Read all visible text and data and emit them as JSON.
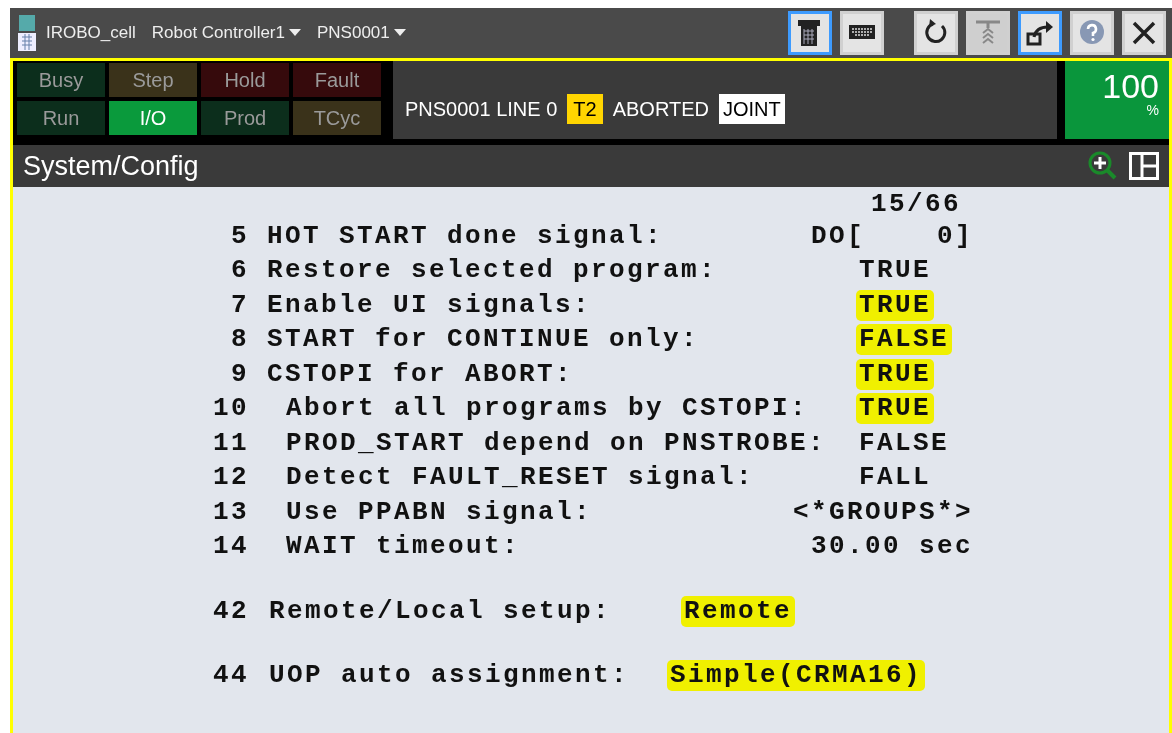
{
  "titlebar": {
    "app": "IROBO_cell",
    "controller": "Robot Controller1",
    "program": "PNS0001",
    "buttons": [
      {
        "kind": "pendant",
        "selected": true,
        "disabled": false
      },
      {
        "kind": "keyboard",
        "selected": false,
        "disabled": false
      },
      {
        "kind": "refresh",
        "selected": false,
        "disabled": false
      },
      {
        "kind": "hold",
        "selected": false,
        "disabled": true
      },
      {
        "kind": "export",
        "selected": true,
        "disabled": false
      },
      {
        "kind": "help",
        "selected": false,
        "disabled": false
      },
      {
        "kind": "close",
        "selected": false,
        "disabled": false
      }
    ]
  },
  "lights": [
    {
      "label": "Busy",
      "color": "#0c2e1c",
      "on": false
    },
    {
      "label": "Step",
      "color": "#3a321a",
      "on": false
    },
    {
      "label": "Hold",
      "color": "#360a0c",
      "on": false
    },
    {
      "label": "Fault",
      "color": "#360a0c",
      "on": false
    },
    {
      "label": "Run",
      "color": "#0c2e1c",
      "on": false
    },
    {
      "label": "I/O",
      "color": "#0a9a3c",
      "on": true
    },
    {
      "label": "Prod",
      "color": "#0c2e1c",
      "on": false
    },
    {
      "label": "TCyc",
      "color": "#3a321a",
      "on": false
    }
  ],
  "status_line": [
    {
      "text": "PNS0001 LINE 0",
      "kind": "plain"
    },
    {
      "text": "T2",
      "kind": "mode"
    },
    {
      "text": "ABORTED",
      "kind": "plain"
    },
    {
      "text": "JOINT",
      "kind": "frame"
    }
  ],
  "override": {
    "value": "100",
    "unit": "%"
  },
  "screen": {
    "title": "System/Config",
    "page": "15/66",
    "rows": [
      {
        "number": "5",
        "label": "HOT START done signal:",
        "value": "DO[    0]",
        "highlighted": false
      },
      {
        "number": "6",
        "label": "Restore selected program:",
        "value": "TRUE",
        "highlighted": false
      },
      {
        "number": "7",
        "label": "Enable UI signals:",
        "value": "TRUE",
        "highlighted": true
      },
      {
        "number": "8",
        "label": "START for CONTINUE only:",
        "value": "FALSE",
        "highlighted": true
      },
      {
        "number": "9",
        "label": "CSTOPI for ABORT:",
        "value": "TRUE",
        "highlighted": true
      },
      {
        "number": "10",
        "label": "Abort all programs by CSTOPI:",
        "value": "TRUE",
        "highlighted": true
      },
      {
        "number": "11",
        "label": "PROD_START depend on PNSTROBE:",
        "value": "FALSE",
        "highlighted": false
      },
      {
        "number": "12",
        "label": "Detect FAULT_RESET signal:",
        "value": "FALL",
        "highlighted": false
      },
      {
        "number": "13",
        "label": "Use PPABN signal:",
        "value": "<*GROUPS*>",
        "highlighted": false
      },
      {
        "number": "14",
        "label": "WAIT timeout:",
        "value": "30.00 sec",
        "highlighted": false
      }
    ],
    "setup_rows": [
      {
        "number": "42",
        "label": "Remote/Local setup:",
        "value": "Remote",
        "highlighted": true
      },
      {
        "number": "44",
        "label": "UOP auto assignment:",
        "value": "Simple(CRMA16)",
        "highlighted": true
      }
    ]
  }
}
